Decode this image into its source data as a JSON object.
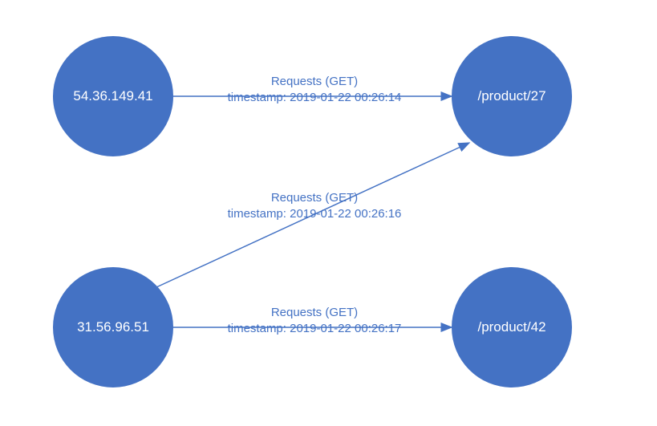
{
  "nodes": {
    "ip1": {
      "label": "54.36.149.41"
    },
    "ip2": {
      "label": "31.56.96.51"
    },
    "resource1": {
      "label": "/product/27"
    },
    "resource2": {
      "label": "/product/42"
    }
  },
  "edges": {
    "e1": {
      "action": "Requests (GET)",
      "timestamp": "timestamp: 2019-01-22 00:26:14"
    },
    "e2": {
      "action": "Requests (GET)",
      "timestamp": "timestamp: 2019-01-22 00:26:16"
    },
    "e3": {
      "action": "Requests (GET)",
      "timestamp": "timestamp: 2019-01-22 00:26:17"
    }
  },
  "colors": {
    "node_fill": "#4472C4",
    "edge_stroke": "#4472C4",
    "text": "#4472C4"
  }
}
